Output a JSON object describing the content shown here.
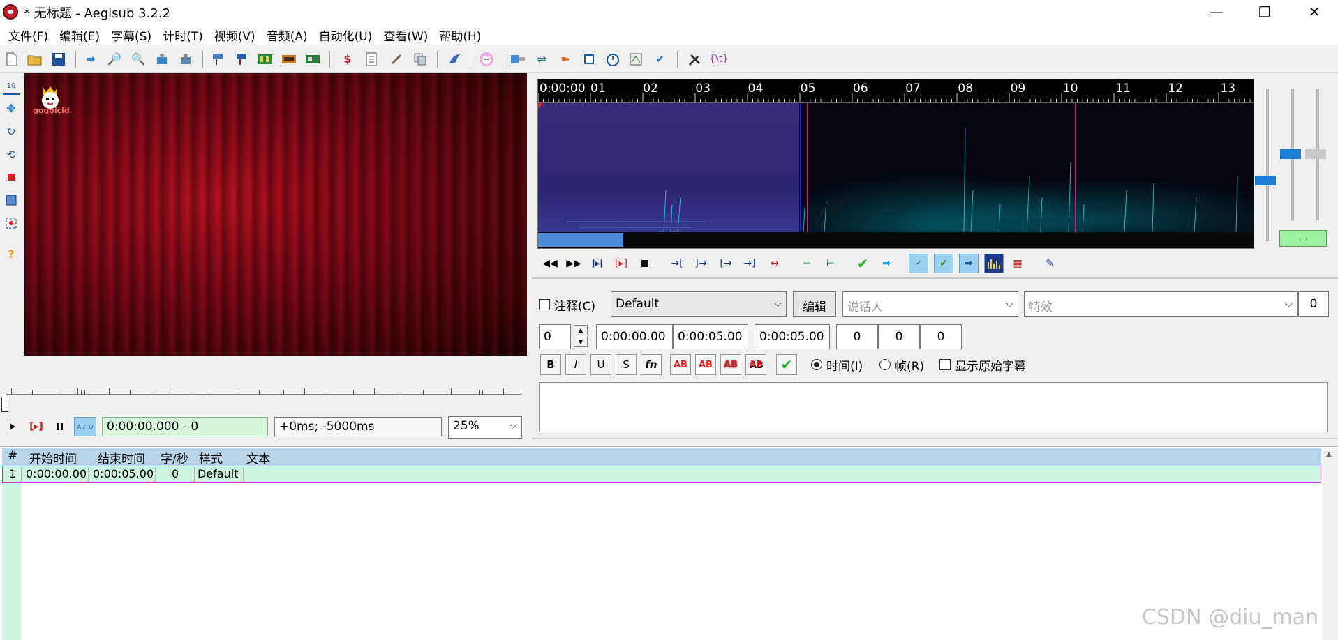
{
  "window": {
    "title": "* 无标题 - Aegisub 3.2.2",
    "minimize": "—",
    "maximize": "❐",
    "close": "✕"
  },
  "menu": [
    "文件(F)",
    "编辑(E)",
    "字幕(S)",
    "计时(T)",
    "视频(V)",
    "音频(A)",
    "自动化(U)",
    "查看(W)",
    "帮助(H)"
  ],
  "video": {
    "logo_text": "gogoicid",
    "time_display": "0:00:00.000 - 0",
    "offset_display": "+0ms; -5000ms",
    "zoom": "25%"
  },
  "audio": {
    "ruler": [
      "0:00:00",
      "01",
      "02",
      "03",
      "04",
      "05",
      "06",
      "07",
      "08",
      "09",
      "10",
      "11",
      "12",
      "13"
    ]
  },
  "edit": {
    "comment_label": "注释(C)",
    "style": "Default",
    "edit_button": "编辑",
    "actor_placeholder": "说话人",
    "effect_placeholder": "特效",
    "char_count": "0",
    "layer": "0",
    "start_time": "0:00:00.00",
    "end_time": "0:00:05.00",
    "duration": "0:00:05.00",
    "margin_l": "0",
    "margin_r": "0",
    "margin_v": "0",
    "time_radio": "时间(I)",
    "frame_radio": "帧(R)",
    "show_original": "显示原始字幕",
    "format_buttons": [
      "B",
      "I",
      "U",
      "S",
      "fn",
      "AB",
      "AB",
      "AB",
      "AB"
    ]
  },
  "grid": {
    "headers": [
      "#",
      "开始时间",
      "结束时间",
      "字/秒",
      "样式",
      "文本"
    ],
    "rows": [
      {
        "num": "1",
        "start": "0:00:00.00",
        "end": "0:00:05.00",
        "cps": "0",
        "style": "Default",
        "text": ""
      }
    ]
  },
  "watermark": "CSDN @diu_man",
  "colors": {
    "active_row": "#cff4df",
    "grid_header": "#b8d4e8",
    "audio_selection": "#2f2575",
    "accent_blue": "#1d7ed8"
  }
}
